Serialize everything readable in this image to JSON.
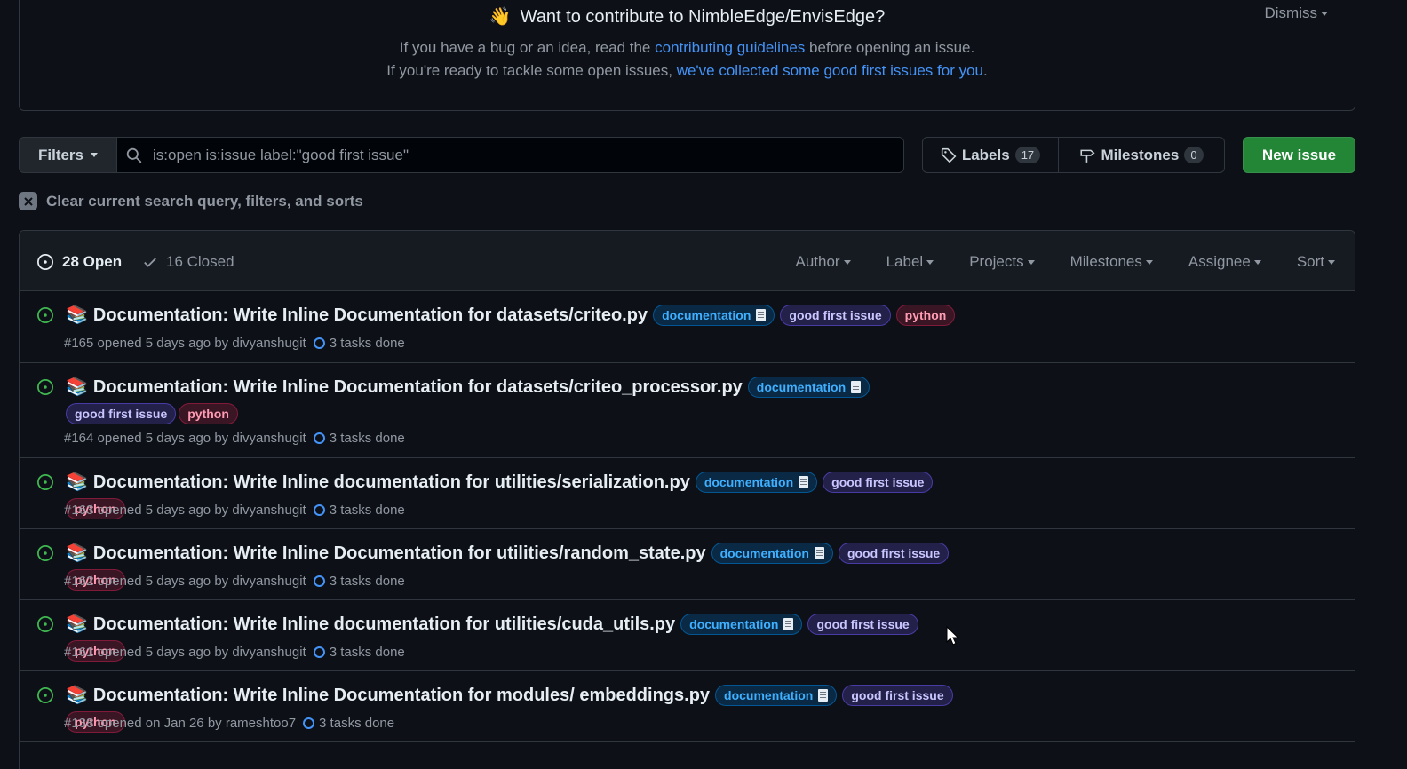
{
  "banner": {
    "title": "Want to contribute to NimbleEdge/EnvisEdge?",
    "line1_before": "If you have a bug or an idea, read the ",
    "line1_link": "contributing guidelines",
    "line1_after": " before opening an issue.",
    "line2_before": "If you're ready to tackle some open issues, ",
    "line2_link": "we've collected some good first issues for you",
    "line2_after": ".",
    "dismiss": "Dismiss"
  },
  "search": {
    "filters_label": "Filters",
    "query": "is:open is:issue label:\"good first issue\""
  },
  "toolbar": {
    "labels_label": "Labels",
    "labels_count": "17",
    "milestones_label": "Milestones",
    "milestones_count": "0",
    "new_issue": "New issue"
  },
  "clear_label": "Clear current search query, filters, and sorts",
  "header": {
    "open_label": "28 Open",
    "closed_label": "16 Closed",
    "filters": [
      "Author",
      "Label",
      "Projects",
      "Milestones",
      "Assignee",
      "Sort"
    ]
  },
  "issues": [
    {
      "title": "Documentation: Write Inline Documentation for datasets/criteo.py",
      "meta": "#165 opened 5 days ago by divyanshugit",
      "tasks": "3 tasks done"
    },
    {
      "title": "Documentation: Write Inline Documentation for datasets/criteo_processor.py",
      "meta": "#164 opened 5 days ago by divyanshugit",
      "tasks": "3 tasks done"
    },
    {
      "title": "Documentation: Write Inline documentation for utilities/serialization.py",
      "meta": "#163 opened 5 days ago by divyanshugit",
      "tasks": "3 tasks done"
    },
    {
      "title": "Documentation: Write Inline Documentation for utilities/random_state.py",
      "meta": "#162 opened 5 days ago by divyanshugit",
      "tasks": "3 tasks done"
    },
    {
      "title": "Documentation: Write Inline documentation for utilities/cuda_utils.py",
      "meta": "#161 opened 5 days ago by divyanshugit",
      "tasks": "3 tasks done"
    },
    {
      "title": "Documentation: Write Inline Documentation for modules/ embeddings.py",
      "meta": "#138 opened on Jan 26 by rameshtoo7",
      "tasks": "3 tasks done"
    }
  ],
  "labels": {
    "documentation": "documentation",
    "good_first_issue": "good first issue",
    "python": "python"
  },
  "colors": {
    "background": "#0d1117",
    "link": "#4493f8",
    "new_issue_green": "#238636",
    "open_icon": "#3fb950"
  }
}
